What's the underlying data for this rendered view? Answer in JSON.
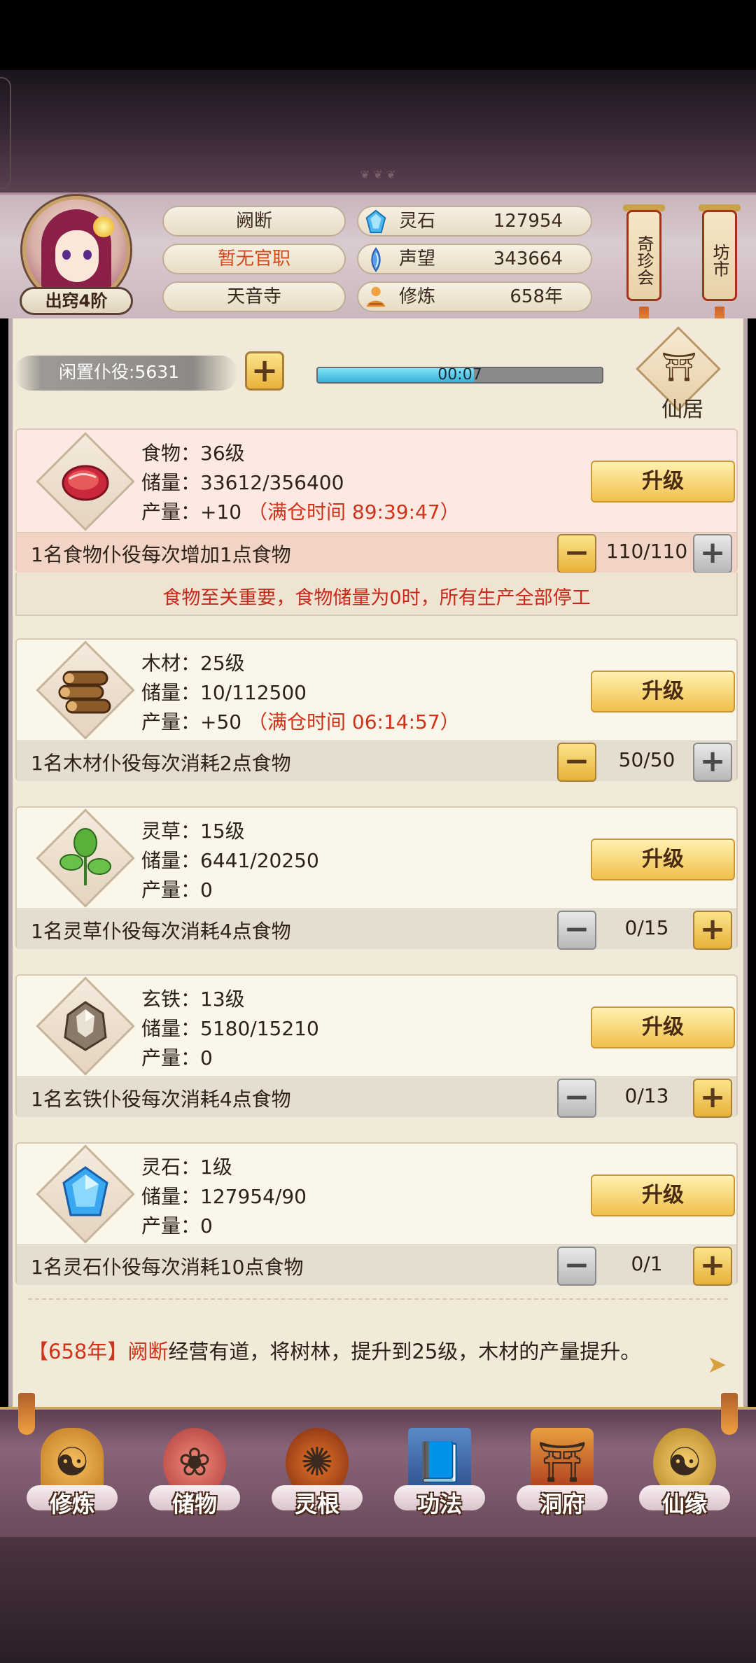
{
  "header": {
    "rank_label": "出窍4阶",
    "character_name": "阙断",
    "official_title": "暂无官职",
    "sect": "天音寺",
    "stats": [
      {
        "label": "灵石",
        "value": "127954",
        "icon": "spirit-stone-icon"
      },
      {
        "label": "声望",
        "value": "343664",
        "icon": "reputation-icon"
      },
      {
        "label": "修炼",
        "value": "658年",
        "icon": "cultivation-icon"
      }
    ],
    "scroll_buttons": [
      {
        "label": "奇珍会"
      },
      {
        "label": "坊市"
      }
    ]
  },
  "idle": {
    "label": "闲置仆役:5631",
    "plus": "+",
    "timer": "00:07",
    "progress": 0.55
  },
  "xianju": {
    "label": "仙居",
    "glyph": "⛩"
  },
  "resources": [
    {
      "name_line": "食物：36级",
      "storage_line": "储量：33612/356400",
      "output_prefix": "产量：+10",
      "output_full": "（满仓时间 89:39:47）",
      "footer": "1名食物仆役每次增加1点食物",
      "count": "110/110",
      "upgrade": "升级",
      "icon": "meat-icon"
    },
    {
      "name_line": "木材：25级",
      "storage_line": "储量：10/112500",
      "output_prefix": "产量：+50",
      "output_full": "（满仓时间 06:14:57）",
      "footer": "1名木材仆役每次消耗2点食物",
      "count": "50/50",
      "upgrade": "升级",
      "icon": "wood-logs-icon"
    },
    {
      "name_line": "灵草：15级",
      "storage_line": "储量：6441/20250",
      "output_prefix": "产量：0",
      "output_full": "",
      "footer": "1名灵草仆役每次消耗4点食物",
      "count": "0/15",
      "upgrade": "升级",
      "icon": "herb-icon"
    },
    {
      "name_line": "玄铁：13级",
      "storage_line": "储量：5180/15210",
      "output_prefix": "产量：0",
      "output_full": "",
      "footer": "1名玄铁仆役每次消耗4点食物",
      "count": "0/13",
      "upgrade": "升级",
      "icon": "iron-ore-icon"
    },
    {
      "name_line": "灵石：1级",
      "storage_line": "储量：127954/90",
      "output_prefix": "产量：0",
      "output_full": "",
      "footer": "1名灵石仆役每次消耗10点食物",
      "count": "0/1",
      "upgrade": "升级",
      "icon": "spirit-crystal-icon"
    }
  ],
  "warning": "食物至关重要，食物储量为0时，所有生产全部停工",
  "log": {
    "year": "【658年】",
    "name": "阙断",
    "text": "经营有道，将树林，提升到25级，木材的产量提升。"
  },
  "nav": [
    {
      "label": "修炼",
      "icon": "cultivate-icon"
    },
    {
      "label": "储物",
      "icon": "storage-bag-icon"
    },
    {
      "label": "灵根",
      "icon": "spirit-root-icon"
    },
    {
      "label": "功法",
      "icon": "technique-book-icon"
    },
    {
      "label": "洞府",
      "icon": "cave-mansion-icon"
    },
    {
      "label": "仙缘",
      "icon": "immortal-fate-icon"
    }
  ],
  "colors": {
    "accent_red": "#d0321a",
    "gold_button": "#f0c04a",
    "parchment": "#f2ead8",
    "progress_fill": "#3ab0d8"
  }
}
